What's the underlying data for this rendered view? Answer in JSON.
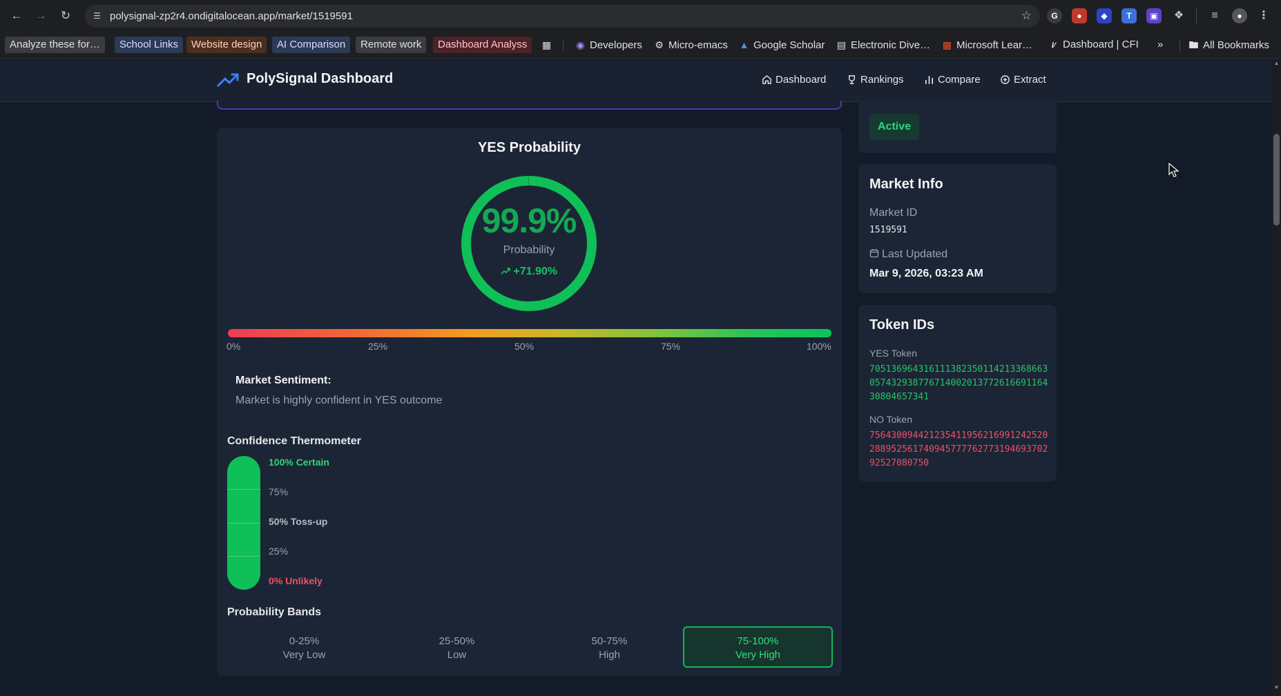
{
  "browser": {
    "url": "polysignal-zp2r4.ondigitalocean.app/market/1519591",
    "bookmarks": [
      "Analyze these for…",
      "School Links",
      "Website design",
      "AI Comparison",
      "Remote work",
      "Dashboard Analyss",
      "Developers",
      "Micro-emacs",
      "Google Scholar",
      "Electronic Dive…",
      "Microsoft Lear…",
      "Dashboard | CFI"
    ],
    "all_bookmarks": "All Bookmarks",
    "more": "»"
  },
  "header": {
    "title": "PolySignal Dashboard",
    "nav": [
      "Dashboard",
      "Rankings",
      "Compare",
      "Extract"
    ]
  },
  "probability": {
    "title": "YES Probability",
    "value": "99.9%",
    "value_fraction": 0.999,
    "label": "Probability",
    "change": "+71.90%",
    "scale_labels": [
      "0%",
      "25%",
      "50%",
      "75%",
      "100%"
    ],
    "sentiment_title": "Market Sentiment:",
    "sentiment_text": "Market is highly confident in YES outcome"
  },
  "thermometer": {
    "title": "Confidence Thermometer",
    "fill_fraction": 0.999,
    "labels": [
      "100% Certain",
      "75%",
      "50% Toss-up",
      "25%",
      "0% Unlikely"
    ]
  },
  "bands": {
    "title": "Probability Bands",
    "items": [
      {
        "range": "0-25%",
        "label": "Very Low"
      },
      {
        "range": "25-50%",
        "label": "Low"
      },
      {
        "range": "50-75%",
        "label": "High"
      },
      {
        "range": "75-100%",
        "label": "Very High"
      }
    ],
    "active_index": 3
  },
  "sidebar": {
    "status": "Active",
    "market_info": {
      "title": "Market Info",
      "id_label": "Market ID",
      "id_value": "1519591",
      "updated_label": "Last Updated",
      "updated_value": "Mar 9, 2026, 03:23 AM"
    },
    "tokens": {
      "title": "Token IDs",
      "yes_label": "YES Token",
      "yes_value": "70513696431611138235011421336866305743293877671400201377261669116430804657341",
      "no_label": "NO Token",
      "no_value": "75643009442123541195621699124252028895256174094577776277319469370292527080750"
    }
  },
  "colors": {
    "accent_green": "#0fbf58",
    "danger_red": "#ef4f66",
    "brand_blue": "#3b82f6",
    "page_bg": "#131a28",
    "card_bg": "#1c2535"
  }
}
